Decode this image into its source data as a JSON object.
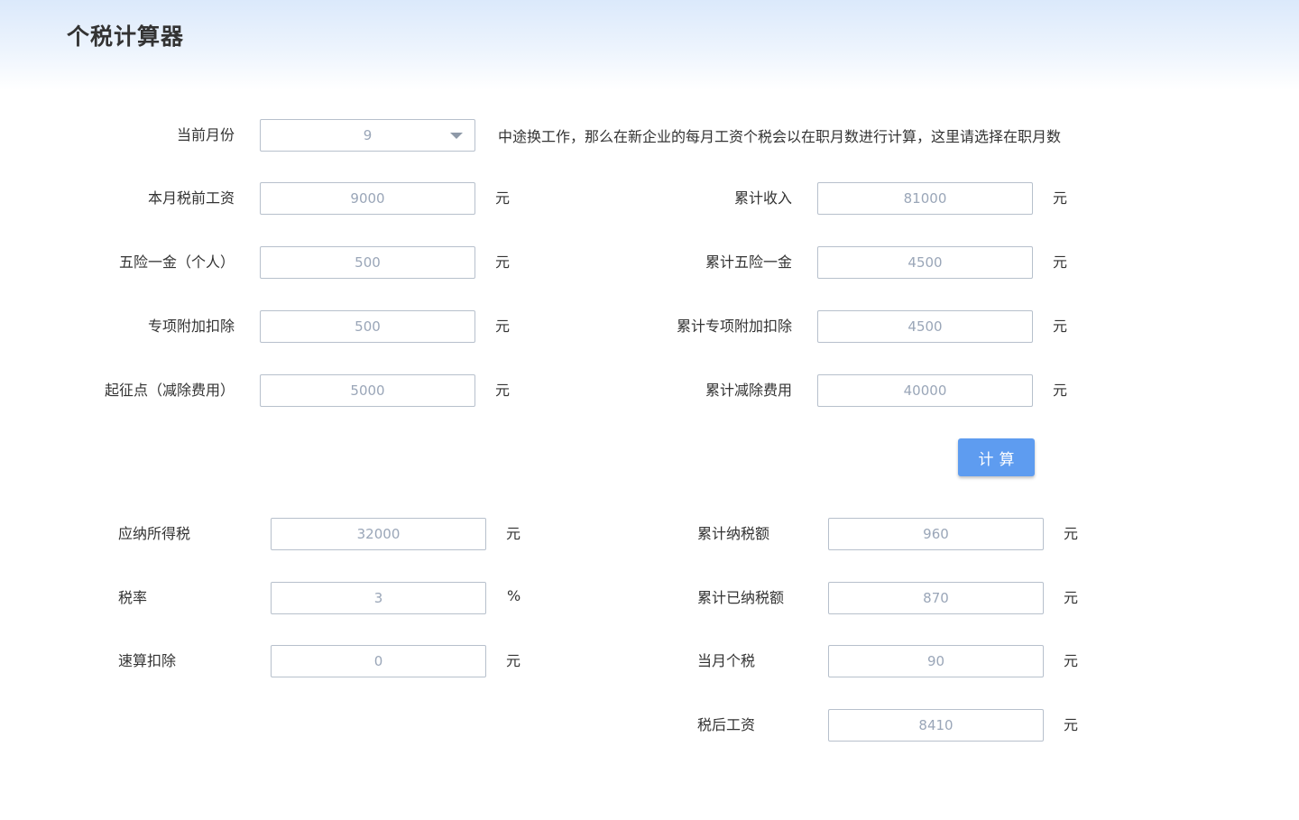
{
  "app": {
    "title": "个税计算器"
  },
  "month": {
    "label": "当前月份",
    "value": "9",
    "note": "中途换工作，那么在新企业的每月工资个税会以在职月数进行计算，这里请选择在职月数"
  },
  "inputs_left": [
    {
      "label": "本月税前工资",
      "value": "9000",
      "unit": "元"
    },
    {
      "label": "五险一金（个人）",
      "value": "500",
      "unit": "元"
    },
    {
      "label": "专项附加扣除",
      "value": "500",
      "unit": "元"
    },
    {
      "label": "起征点（减除费用）",
      "value": "5000",
      "unit": "元"
    }
  ],
  "inputs_right": [
    {
      "label": "累计收入",
      "value": "81000",
      "unit": "元"
    },
    {
      "label": "累计五险一金",
      "value": "4500",
      "unit": "元"
    },
    {
      "label": "累计专项附加扣除",
      "value": "4500",
      "unit": "元"
    },
    {
      "label": "累计减除费用",
      "value": "40000",
      "unit": "元"
    }
  ],
  "calc_button": {
    "label": "计算"
  },
  "results_left": [
    {
      "label": "应纳所得税",
      "value": "32000",
      "unit": "元"
    },
    {
      "label": "税率",
      "value": "3",
      "unit": "%"
    },
    {
      "label": "速算扣除",
      "value": "0",
      "unit": "元"
    }
  ],
  "results_right": [
    {
      "label": "累计纳税额",
      "value": "960",
      "unit": "元"
    },
    {
      "label": "累计已纳税额",
      "value": "870",
      "unit": "元"
    },
    {
      "label": "当月个税",
      "value": "90",
      "unit": "元"
    },
    {
      "label": "税后工资",
      "value": "8410",
      "unit": "元"
    }
  ],
  "colors": {
    "accent": "#5e9cf0",
    "input_border": "#b7c0cc",
    "input_text": "#9aa6b8",
    "header_gradient_top": "#dbe9fb"
  }
}
